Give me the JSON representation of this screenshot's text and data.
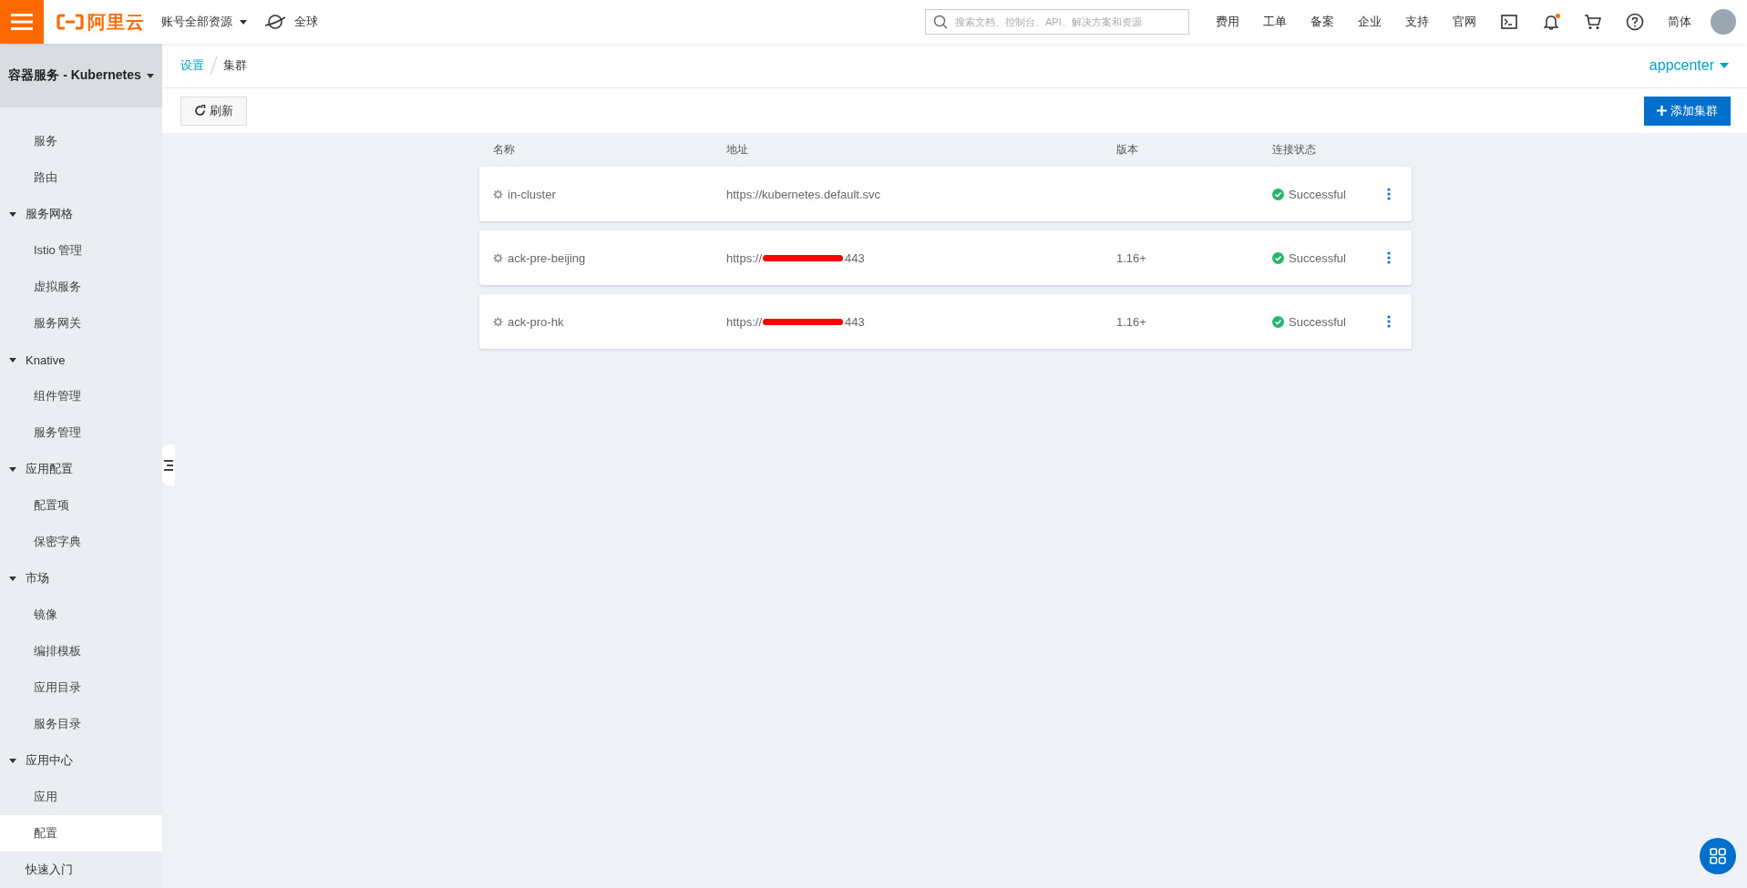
{
  "topbar": {
    "logo": "阿里云",
    "account": "账号全部资源",
    "region": "全球",
    "search": {
      "placeholder": "搜索文档、控制台、API、解决方案和资源"
    },
    "links": [
      "费用",
      "工单",
      "备案",
      "企业",
      "支持",
      "官网"
    ],
    "notification": true,
    "language": "简体"
  },
  "sidebar": {
    "title": "容器服务 - Kubernetes",
    "items": [
      {
        "kind": "sub",
        "label": "服务",
        "selected": false
      },
      {
        "kind": "sub",
        "label": "路由",
        "selected": false
      },
      {
        "kind": "group",
        "label": "服务网格",
        "expanded": true,
        "children": [
          {
            "label": "Istio 管理",
            "selected": false
          },
          {
            "label": "虚拟服务",
            "selected": false
          },
          {
            "label": "服务网关",
            "selected": false
          }
        ]
      },
      {
        "kind": "group",
        "label": "Knative",
        "expanded": true,
        "children": [
          {
            "label": "组件管理",
            "selected": false
          },
          {
            "label": "服务管理",
            "selected": false
          }
        ]
      },
      {
        "kind": "group",
        "label": "应用配置",
        "expanded": true,
        "children": [
          {
            "label": "配置项",
            "selected": false
          },
          {
            "label": "保密字典",
            "selected": false
          }
        ]
      },
      {
        "kind": "group",
        "label": "市场",
        "expanded": true,
        "children": [
          {
            "label": "镜像",
            "selected": false
          },
          {
            "label": "编排模板",
            "selected": false
          },
          {
            "label": "应用目录",
            "selected": false
          },
          {
            "label": "服务目录",
            "selected": false
          }
        ]
      },
      {
        "kind": "group",
        "label": "应用中心",
        "expanded": true,
        "children": [
          {
            "label": "应用",
            "selected": false
          },
          {
            "label": "配置",
            "selected": true
          }
        ]
      },
      {
        "kind": "link",
        "label": "快速入门",
        "selected": false
      }
    ]
  },
  "breadcrumb": [
    "设置",
    "集群"
  ],
  "namespace": "appcenter",
  "toolbar": {
    "refresh": "刷新",
    "add": "添加集群"
  },
  "table": {
    "columns": [
      "名称",
      "地址",
      "版本",
      "连接状态"
    ],
    "rows": [
      {
        "name": "in-cluster",
        "address": {
          "prefix": "https://kubernetes.default.svc"
        },
        "status": "Successful"
      },
      {
        "name": "ack-pre-beijing",
        "address": {
          "prefix": "https://",
          "redacted": true,
          "suffix": "443"
        },
        "version": "1.16+",
        "status": "Successful"
      },
      {
        "name": "ack-pro-hk",
        "address": {
          "prefix": "https://",
          "redacted": true,
          "suffix": "443"
        },
        "version": "1.16+",
        "status": "Successful"
      }
    ]
  }
}
